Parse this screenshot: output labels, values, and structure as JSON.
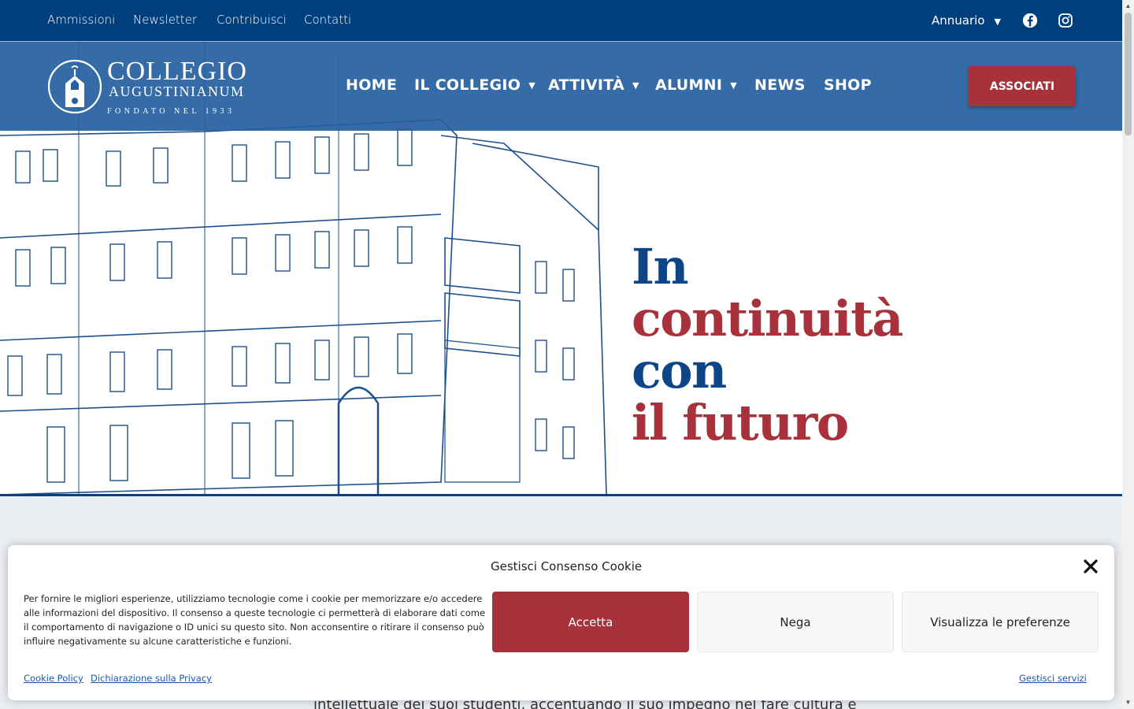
{
  "topbar": {
    "links": [
      "Ammissioni",
      "Newsletter",
      "Contribuisci",
      "Contatti"
    ],
    "annuario": "Annuario",
    "caret": "▼"
  },
  "logo": {
    "name": "COLLEGIO",
    "sub": "AUGUSTINIANUM",
    "founded": "FONDATO NEL 1933"
  },
  "nav": {
    "home": "HOME",
    "collegio": "IL COLLEGIO",
    "attivita": "ATTIVITÀ",
    "alumni": "ALUMNI",
    "news": "NEWS",
    "shop": "SHOP",
    "caret": "▼",
    "cta": "ASSOCIATI"
  },
  "hero": {
    "line1": "In",
    "line2": "continuità",
    "line3": "con",
    "line4": "il futuro"
  },
  "body": {
    "text": "intellettuale dei suoi studenti, accentuando il suo impegno nel fare cultura e"
  },
  "cookie": {
    "title": "Gestisci Consenso Cookie",
    "text": "Per fornire le migliori esperienze, utilizziamo tecnologie come i cookie per memorizzare e/o accedere alle informazioni del dispositivo. Il consenso a queste tecnologie ci permetterà di elaborare dati come il comportamento di navigazione o ID unici su questo sito. Non acconsentire o ritirare il consenso può influire negativamente su alcune caratteristiche e funzioni.",
    "accept": "Accetta",
    "deny": "Nega",
    "prefs": "Visualizza le preferenze",
    "cookie_policy": "Cookie Policy",
    "privacy": "Dichiarazione sulla Privacy",
    "manage": "Gestisci servizi"
  },
  "colors": {
    "topbar": "#003f7d",
    "navbar": "#2660a0",
    "accent_red": "#a8323c",
    "hero_blue": "#0d4586"
  }
}
